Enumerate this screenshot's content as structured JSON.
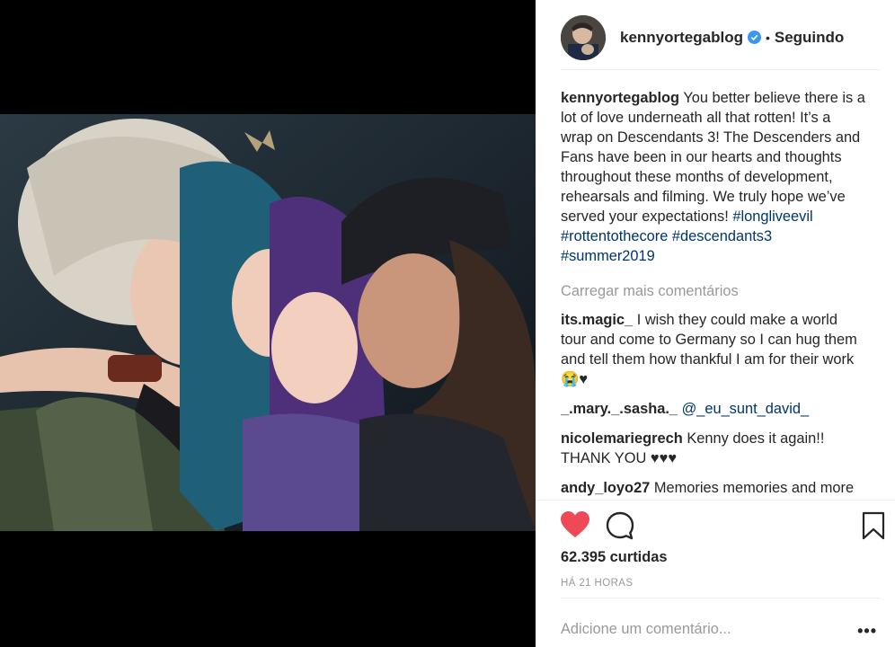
{
  "post": {
    "author": "kennyortegablog",
    "follow_status": "Seguindo",
    "separator": "•",
    "caption": {
      "text": "You better believe there is a lot of love underneath all that rotten! It’s a wrap on Descendants 3! The Descenders and Fans have been in our hearts and thoughts throughout these months of development, rehearsals and filming. We truly hope we’ve served your expectations!",
      "hashtags": "#longliveevil #rottentothecore #descendants3 #summer2019"
    },
    "load_more": "Carregar mais comentários",
    "comments": [
      {
        "user": "its.magic_",
        "text": "I wish they could make a world tour and come to Germany so I can hug them and tell them how thankful I am for their work😭♥",
        "mention": ""
      },
      {
        "user": "_.mary._.sasha._",
        "text": "",
        "mention": "@_eu_sunt_david_"
      },
      {
        "user": "nicolemariegrech",
        "text": "Kenny does it again!! THANK YOU ♥♥♥",
        "mention": ""
      },
      {
        "user": "andy_loyo27",
        "text": "Memories memories and more memories, descendants will be always",
        "mention": ""
      }
    ],
    "likes": "62.395 curtidas",
    "time": "HÁ 21 HORAS",
    "add_comment_placeholder": "Adicione um comentário...",
    "more_options": "•••"
  },
  "icons": {
    "verified": "verified-badge-icon",
    "like": "heart-icon",
    "comment": "comment-bubble-icon",
    "save": "bookmark-icon"
  },
  "colors": {
    "heart": "#ed4956",
    "verified": "#3897f0",
    "hashtag": "#003569",
    "muted": "#999999"
  }
}
